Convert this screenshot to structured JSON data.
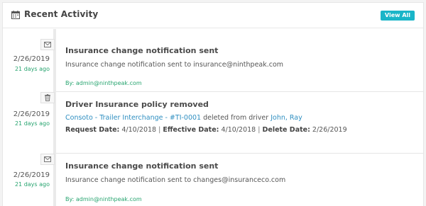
{
  "header": {
    "title": "Recent Activity",
    "view_all": "View All",
    "icon": "calendar-icon"
  },
  "entries": [
    {
      "icon": "envelope-icon",
      "date": "2/26/2019",
      "ago": "21 days ago",
      "title": "Insurance change notification sent",
      "text": "Insurance change notification sent to insurance@ninthpeak.com",
      "by": "By: admin@ninthpeak.com"
    },
    {
      "icon": "trash-icon",
      "date": "2/26/2019",
      "ago": "21 days ago",
      "title": "Driver Insurance policy removed",
      "policy_link": "Consoto - Trailer Interchange - #TI-0001",
      "middle": " deleted from driver ",
      "driver_link": "John, Ray",
      "request_label": "Request Date:",
      "request_value": "4/10/2018",
      "effective_label": "Effective Date:",
      "effective_value": "4/10/2018",
      "delete_label": "Delete Date:",
      "delete_value": "2/26/2019",
      "separator": "|"
    },
    {
      "icon": "envelope-icon",
      "date": "2/26/2019",
      "ago": "21 days ago",
      "title": "Insurance change notification sent",
      "text": "Insurance change notification sent to changes@insuranceco.com",
      "by": "By: admin@ninthpeak.com"
    }
  ]
}
